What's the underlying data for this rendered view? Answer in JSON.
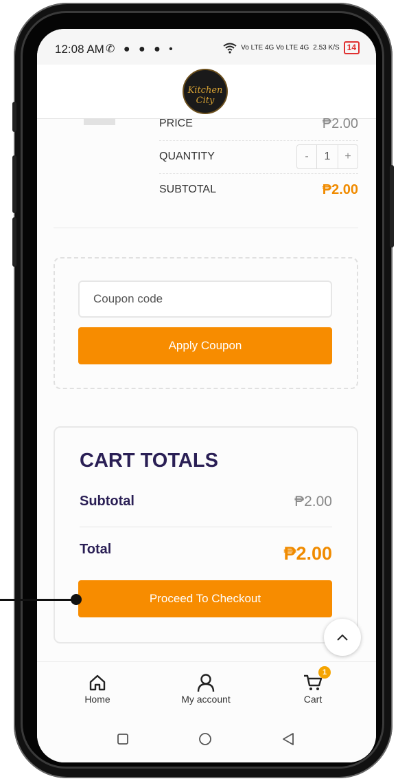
{
  "status_bar": {
    "time": "12:08 AM",
    "left_icons": "✆ ● ● ● •",
    "network": "Vo LTE 4G  Vo LTE 4G",
    "speed": "2.53 K/S",
    "battery": "14"
  },
  "header": {
    "logo_text": "Kitchen City"
  },
  "cart_item": {
    "price_label": "PRICE",
    "price_value": "₱2.00",
    "quantity_label": "QUANTITY",
    "quantity_minus": "-",
    "quantity_value": "1",
    "quantity_plus": "+",
    "subtotal_label": "SUBTOTAL",
    "subtotal_value": "₱2.00"
  },
  "coupon": {
    "placeholder": "Coupon code",
    "value": "",
    "apply_label": "Apply Coupon"
  },
  "cart_totals": {
    "title": "CART TOTALS",
    "subtotal_label": "Subtotal",
    "subtotal_value": "₱2.00",
    "total_label": "Total",
    "total_value": "₱2.00",
    "checkout_label": "Proceed To Checkout"
  },
  "bottom_nav": {
    "items": [
      {
        "label": "Home",
        "icon": "home-icon"
      },
      {
        "label": "My account",
        "icon": "user-icon"
      },
      {
        "label": "Cart",
        "icon": "cart-icon",
        "badge": "1"
      }
    ]
  },
  "colors": {
    "accent": "#f78c00",
    "heading": "#2a1f55",
    "badge": "#f5a400"
  }
}
